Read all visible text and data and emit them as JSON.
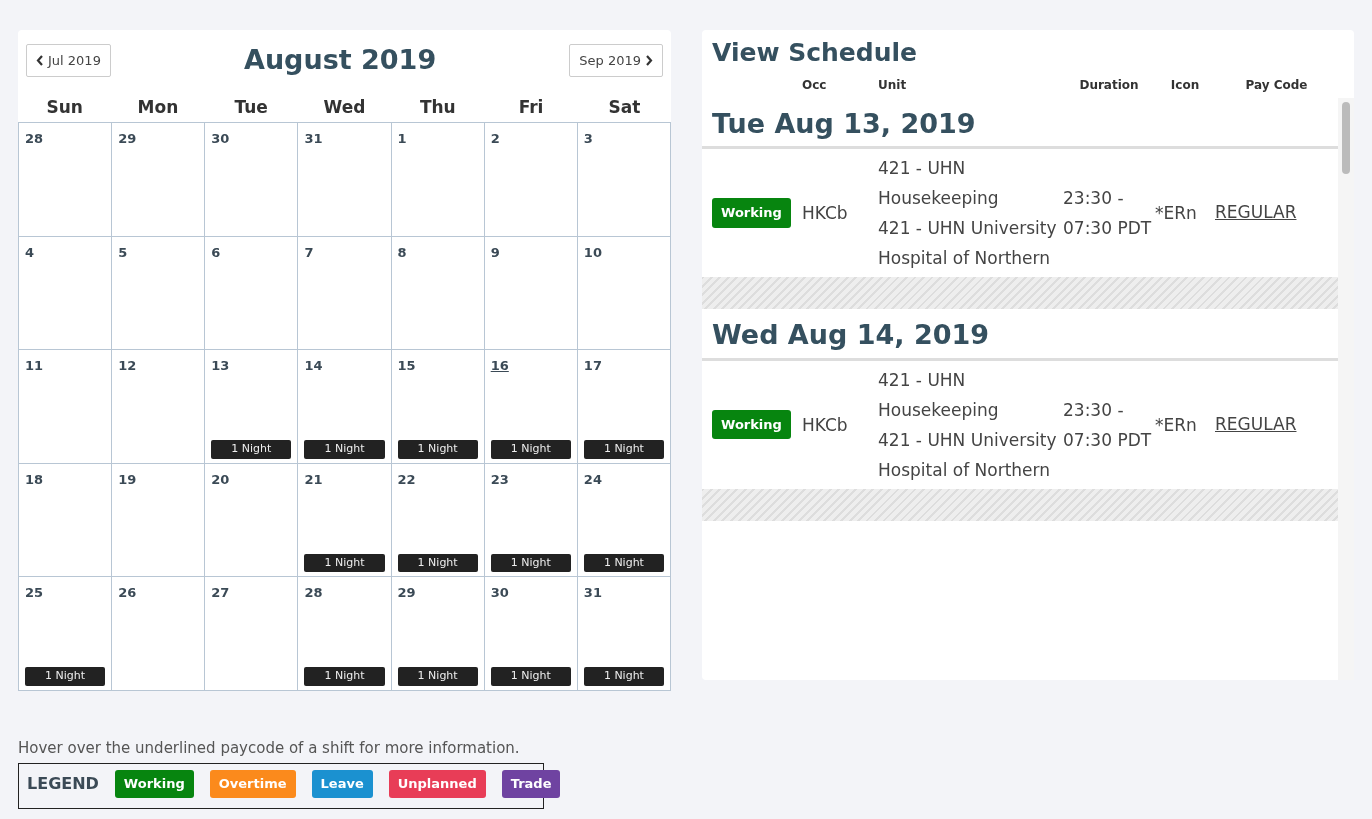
{
  "calendar": {
    "prev_button": "Jul 2019",
    "title": "August 2019",
    "next_button": "Sep 2019",
    "weekdays": [
      "Sun",
      "Mon",
      "Tue",
      "Wed",
      "Thu",
      "Fri",
      "Sat"
    ],
    "days": [
      {
        "day": "28",
        "today": false
      },
      {
        "day": "29",
        "today": false
      },
      {
        "day": "30",
        "today": false
      },
      {
        "day": "31",
        "today": false
      },
      {
        "day": "1",
        "today": false
      },
      {
        "day": "2",
        "today": false
      },
      {
        "day": "3",
        "today": false
      },
      {
        "day": "4",
        "today": false
      },
      {
        "day": "5",
        "today": false
      },
      {
        "day": "6",
        "today": false
      },
      {
        "day": "7",
        "today": false
      },
      {
        "day": "8",
        "today": false
      },
      {
        "day": "9",
        "today": false
      },
      {
        "day": "10",
        "today": false
      },
      {
        "day": "11",
        "today": false
      },
      {
        "day": "12",
        "today": false
      },
      {
        "day": "13",
        "today": false,
        "shift": "1 Night"
      },
      {
        "day": "14",
        "today": false,
        "shift": "1 Night"
      },
      {
        "day": "15",
        "today": false,
        "shift": "1 Night"
      },
      {
        "day": "16",
        "today": true,
        "shift": "1 Night"
      },
      {
        "day": "17",
        "today": false,
        "shift": "1 Night"
      },
      {
        "day": "18",
        "today": false
      },
      {
        "day": "19",
        "today": false
      },
      {
        "day": "20",
        "today": false
      },
      {
        "day": "21",
        "today": false,
        "shift": "1 Night"
      },
      {
        "day": "22",
        "today": false,
        "shift": "1 Night"
      },
      {
        "day": "23",
        "today": false,
        "shift": "1 Night"
      },
      {
        "day": "24",
        "today": false,
        "shift": "1 Night"
      },
      {
        "day": "25",
        "today": false,
        "shift": "1 Night"
      },
      {
        "day": "26",
        "today": false
      },
      {
        "day": "27",
        "today": false
      },
      {
        "day": "28",
        "today": false,
        "shift": "1 Night"
      },
      {
        "day": "29",
        "today": false,
        "shift": "1 Night"
      },
      {
        "day": "30",
        "today": false,
        "shift": "1 Night"
      },
      {
        "day": "31",
        "today": false,
        "shift": "1 Night"
      }
    ]
  },
  "schedule": {
    "title": "View Schedule",
    "columns": [
      "Occ",
      "Unit",
      "Duration",
      "Icon",
      "Pay Code"
    ],
    "days": [
      {
        "date": "Tue Aug 13, 2019",
        "shifts": [
          {
            "status": "Working",
            "color": "#07850f",
            "occ": "HKCb",
            "unit": [
              "421 - UHN Housekeeping",
              "421 - UHN University Hospital of Northern"
            ],
            "duration": "23:30 - 07:30 PDT",
            "icon": "*ERn",
            "pay_code": "REGULAR"
          }
        ]
      },
      {
        "date": "Wed Aug 14, 2019",
        "shifts": [
          {
            "status": "Working",
            "color": "#07850f",
            "occ": "HKCb",
            "unit": [
              "421 - UHN Housekeeping",
              "421 - UHN University Hospital of Northern"
            ],
            "duration": "23:30 - 07:30 PDT",
            "icon": "*ERn",
            "pay_code": "REGULAR"
          }
        ]
      }
    ]
  },
  "hint": "Hover over the underlined paycode of a shift for more information.",
  "legend": {
    "title": "LEGEND",
    "items": [
      {
        "label": "Working",
        "color": "#07850f"
      },
      {
        "label": "Overtime",
        "color": "#fb8a1c"
      },
      {
        "label": "Leave",
        "color": "#1b91d0"
      },
      {
        "label": "Unplanned",
        "color": "#e83d57"
      },
      {
        "label": "Trade",
        "color": "#6f43a1"
      }
    ]
  }
}
